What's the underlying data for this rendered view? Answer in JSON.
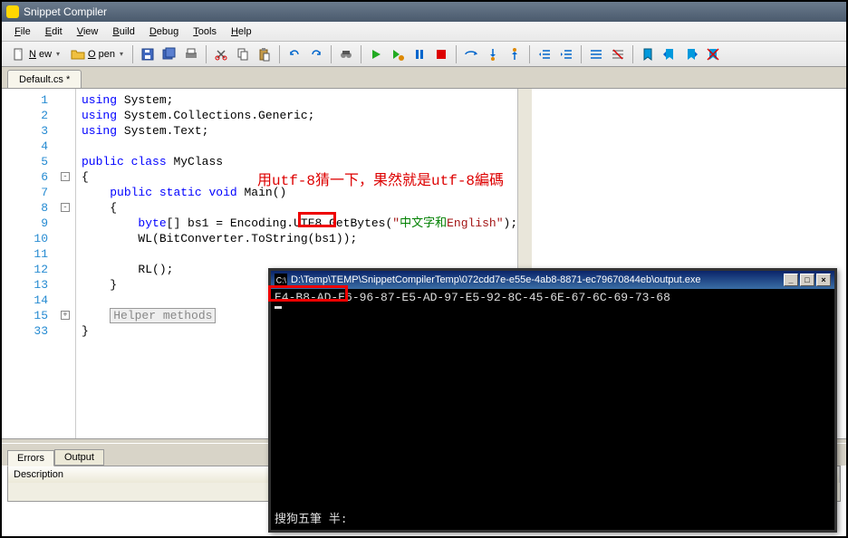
{
  "window": {
    "title": "Snippet Compiler"
  },
  "menus": [
    "File",
    "Edit",
    "View",
    "Build",
    "Debug",
    "Tools",
    "Help"
  ],
  "toolbar": {
    "new": "New",
    "open": "Open"
  },
  "tabs": {
    "active": "Default.cs *"
  },
  "code": {
    "lines": [
      {
        "n": 1,
        "rich": "<span class='kw'>using</span> System;"
      },
      {
        "n": 2,
        "rich": "<span class='kw'>using</span> System.Collections.Generic;"
      },
      {
        "n": 3,
        "rich": "<span class='kw'>using</span> System.Text;"
      },
      {
        "n": 4,
        "rich": ""
      },
      {
        "n": 5,
        "rich": "<span class='kw'>public</span> <span class='kw'>class</span> MyClass"
      },
      {
        "n": 6,
        "rich": "{",
        "fold": "-"
      },
      {
        "n": 7,
        "rich": "    <span class='kw'>public</span> <span class='kw'>static</span> <span class='kw'>void</span> Main()"
      },
      {
        "n": 8,
        "rich": "    {",
        "fold": "-"
      },
      {
        "n": 9,
        "rich": "        <span class='kw'>byte</span>[] bs1 = Encoding.UTF8.GetBytes(<span class='str'>\"</span><span class='str-cjk'>中文字和</span><span class='str'>English\"</span>);"
      },
      {
        "n": 10,
        "rich": "        WL(BitConverter.ToString(bs1));"
      },
      {
        "n": 11,
        "rich": ""
      },
      {
        "n": 12,
        "rich": "        RL();"
      },
      {
        "n": 13,
        "rich": "    }"
      },
      {
        "n": 14,
        "rich": ""
      },
      {
        "n": 15,
        "rich": "    <span class='helper'>Helper methods</span>",
        "fold": "+"
      },
      {
        "n": 33,
        "rich": "}"
      }
    ]
  },
  "annotation": "用utf-8猜一下，果然就是utf-8編碼",
  "bottom_tabs": [
    "Errors",
    "Output"
  ],
  "grid_col": "Description",
  "console": {
    "title_prefix": "D:\\Temp\\TEMP\\SnippetCompilerTemp\\072cdd7e-e55e-4ab8-8871-ec79670844eb\\output.exe",
    "output": "E4-B8-AD-E6-96-87-E5-AD-97-E5-92-8C-45-6E-67-6C-69-73-68",
    "ime": "搜狗五筆 半:"
  }
}
